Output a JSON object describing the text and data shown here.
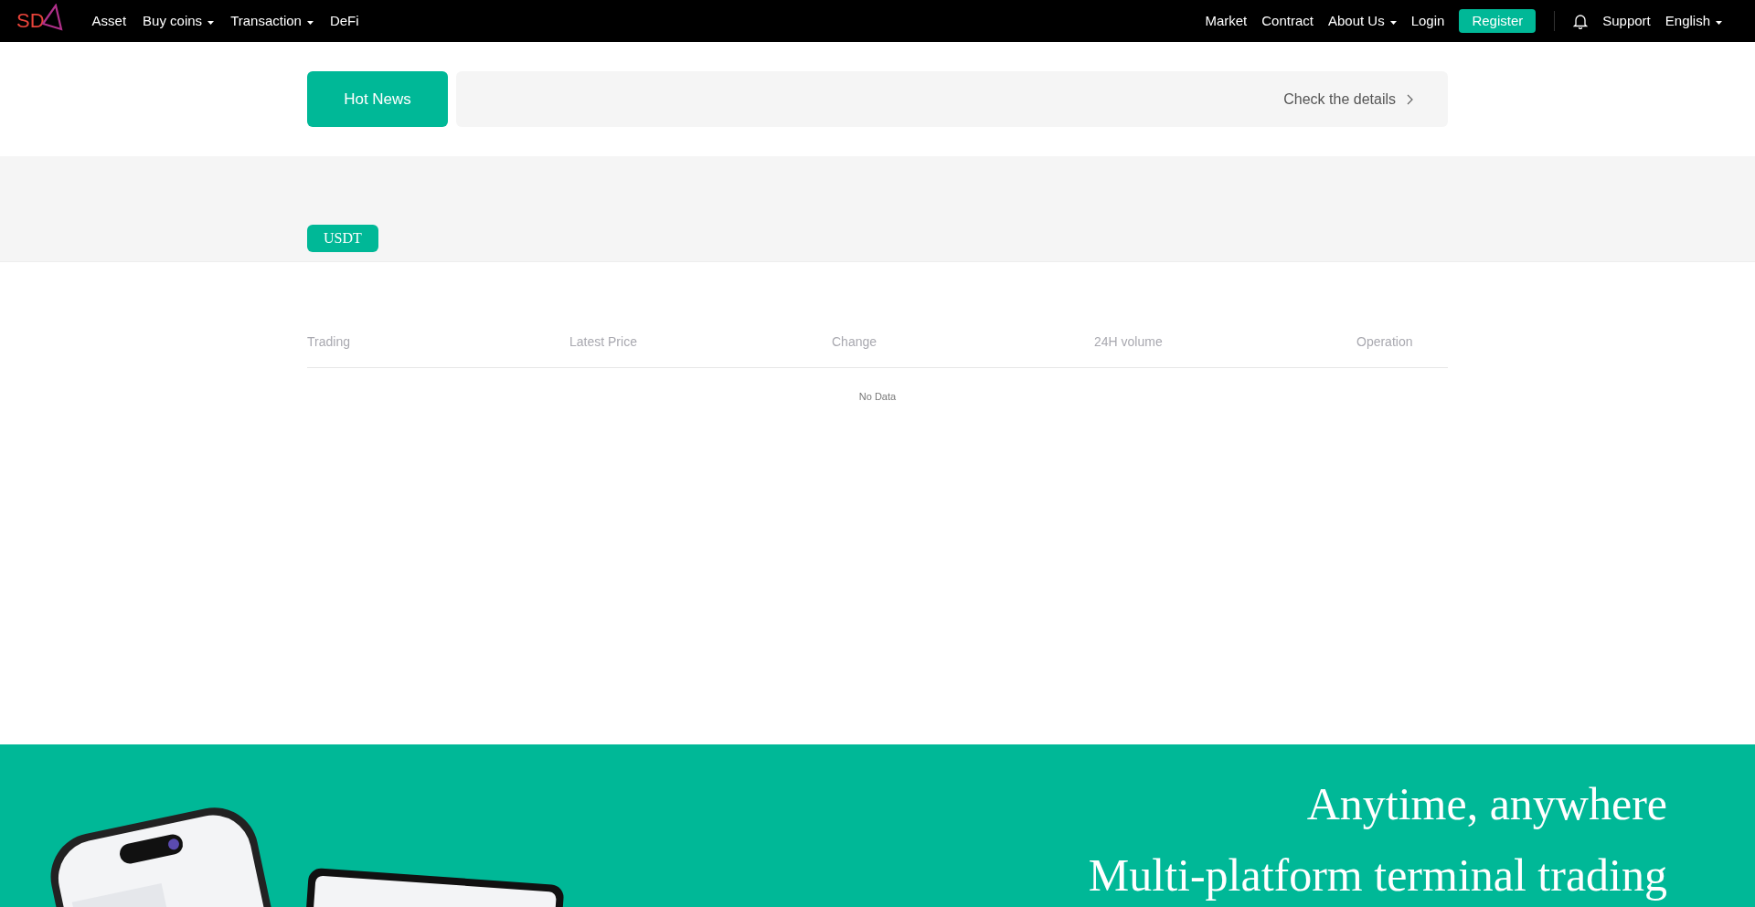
{
  "nav": {
    "logo": "SD",
    "left": [
      {
        "label": "Asset",
        "dropdown": false
      },
      {
        "label": "Buy coins",
        "dropdown": true
      },
      {
        "label": "Transaction",
        "dropdown": true
      },
      {
        "label": "DeFi",
        "dropdown": false
      }
    ],
    "right": [
      {
        "label": "Market",
        "dropdown": false
      },
      {
        "label": "Contract",
        "dropdown": false
      },
      {
        "label": "About Us",
        "dropdown": true
      },
      {
        "label": "Login",
        "dropdown": false
      }
    ],
    "register": "Register",
    "support": "Support",
    "language": "English"
  },
  "news": {
    "title": "Hot News",
    "link": "Check the details"
  },
  "tabs": [
    {
      "label": "USDT",
      "selected": true
    }
  ],
  "table": {
    "columns": [
      "Trading",
      "Latest Price",
      "Change",
      "24H volume",
      "Operation"
    ],
    "empty": "No Data"
  },
  "promo": {
    "lines": [
      "Anytime, anywhere",
      "Multi-platform terminal trading"
    ]
  }
}
